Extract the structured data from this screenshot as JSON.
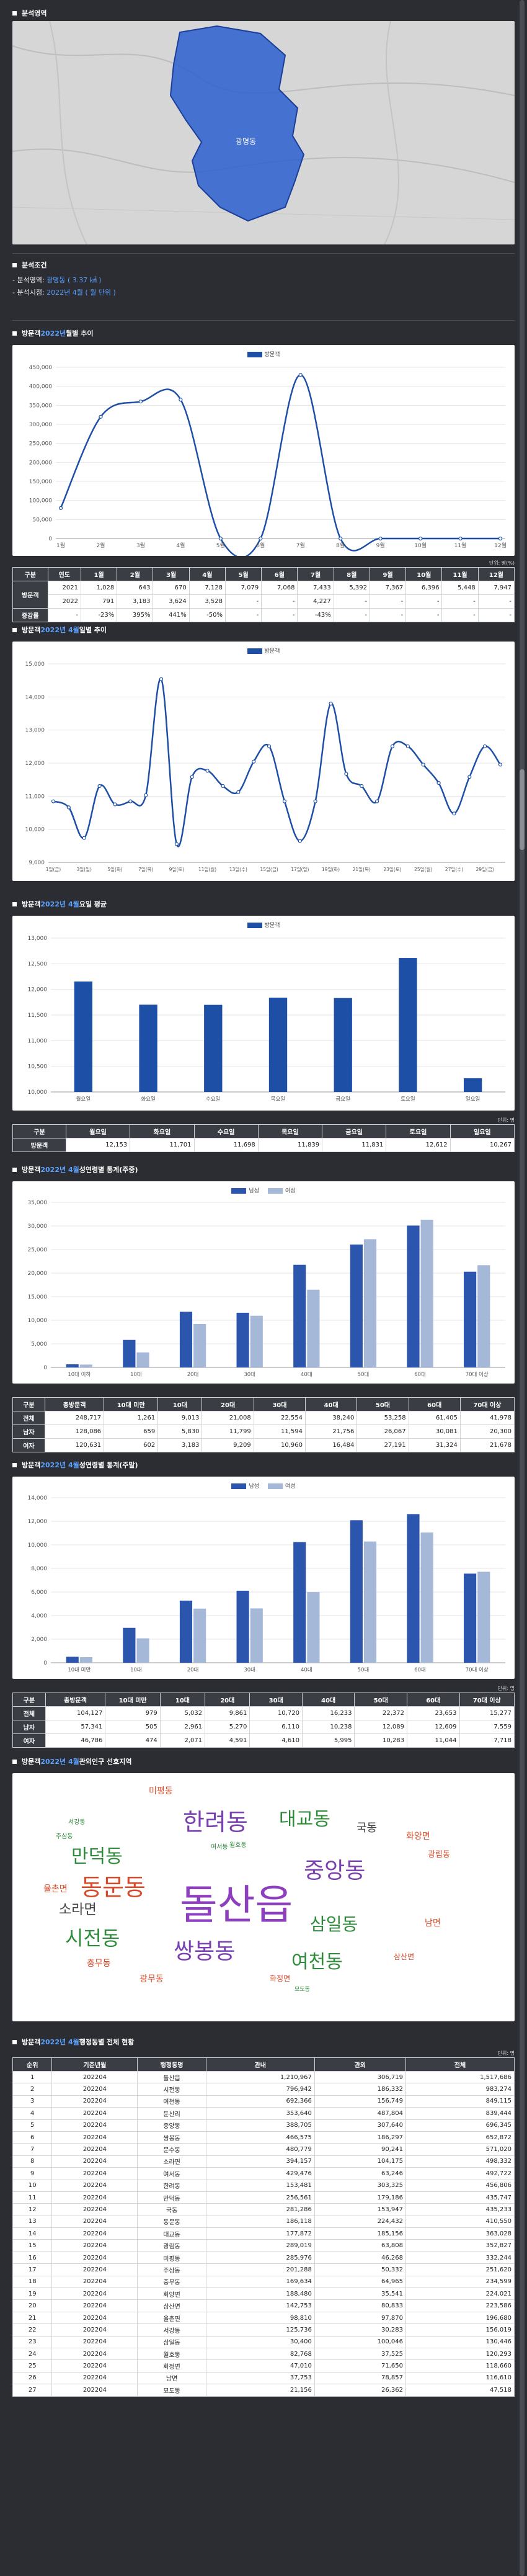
{
  "sections": {
    "area": "분석영역",
    "cond": "분석조건",
    "monthly": {
      "pre": "방문객 ",
      "year": "2022년",
      "post": " 월별 추이"
    },
    "daily": {
      "pre": "방문객 ",
      "period": "2022년 4월",
      "post": " 일별 추이"
    },
    "weekday": {
      "pre": "방문객 ",
      "period": "2022년 4월",
      "post": " 요일 평균"
    },
    "demo_weekday": {
      "pre": "방문객 ",
      "period": "2022년 4월",
      "post": " 성연령별 통계(주중)"
    },
    "demo_weekend": {
      "pre": "방문객 ",
      "period": "2022년 4월",
      "post": " 성연령별 통계(주말)"
    },
    "related": {
      "pre": "방문객 ",
      "period": "2022년 4월",
      "post": " 관외인구 선호지역"
    },
    "admin": {
      "pre": "방문객 ",
      "period": "2022년 4월",
      "post": " 행정동별 전체 현황"
    }
  },
  "conditions": {
    "area_label": "- 분석영역: ",
    "area_value": "광명동 ( 3.37 ㎢ )",
    "time_label": "- 분석시점: ",
    "time_value": "2022년 4월 ( 월 단위 )"
  },
  "map": {
    "label": "광명동"
  },
  "unit_label": "단위: 명",
  "unit_label_pct": "단위: 명(%)",
  "colors": {
    "primary": "#1e4fa6",
    "male": "#2c56ad",
    "female": "#a6b8d8",
    "accent": "#5aa0ff"
  },
  "monthly_chart": {
    "type": "line",
    "legend": "방문객",
    "categories": [
      "1월",
      "2월",
      "3월",
      "4월",
      "5월",
      "6월",
      "7월",
      "8월",
      "9월",
      "10월",
      "11월",
      "12월"
    ],
    "values": [
      80000,
      320000,
      360000,
      365000,
      0,
      0,
      430000,
      0,
      0,
      0,
      0,
      0
    ],
    "ylim": [
      0,
      450000
    ],
    "yticks": [
      "0",
      "50,000",
      "100,000",
      "150,000",
      "200,000",
      "250,000",
      "300,000",
      "350,000",
      "400,000",
      "450,000"
    ]
  },
  "monthly_table": {
    "headers": [
      "구분",
      "연도",
      "1월",
      "2월",
      "3월",
      "4월",
      "5월",
      "6월",
      "7월",
      "8월",
      "9월",
      "10월",
      "11월",
      "12월"
    ],
    "row_header": "방문객",
    "rows": [
      [
        "2021",
        "1,028",
        "643",
        "670",
        "7,128",
        "7,079",
        "7,068",
        "7,433",
        "5,392",
        "7,367",
        "6,396",
        "5,448",
        "7,947"
      ],
      [
        "2022",
        "791",
        "3,183",
        "3,624",
        "3,528",
        "-",
        "-",
        "4,227",
        "-",
        "-",
        "-",
        "-",
        "-"
      ]
    ],
    "growth": [
      "증감률",
      "-",
      "-23%",
      "395%",
      "441%",
      "-50%",
      "-",
      "-",
      "-43%",
      "-",
      "-",
      "-",
      "-",
      "-"
    ]
  },
  "daily_chart": {
    "type": "line",
    "legend": "방문객",
    "categories": [
      "1일(금)",
      "3일(일)",
      "5일(화)",
      "7일(목)",
      "9일(토)",
      "11일(월)",
      "13일(수)",
      "15일(금)",
      "17일(일)",
      "19일(화)",
      "21일(목)",
      "23일(토)",
      "25일(월)",
      "27일(수)",
      "29일(금)"
    ],
    "values": [
      11000,
      10800,
      9800,
      11500,
      10900,
      11000,
      11200,
      15000,
      9600,
      11800,
      12000,
      11500,
      11300,
      12300,
      12800,
      11000,
      9700,
      11000,
      14200,
      11900,
      11500,
      11000,
      12800,
      12800,
      12200,
      11600,
      10600,
      11800,
      12800,
      12200
    ],
    "ylim": [
      9000,
      15500
    ],
    "yticks": [
      "9,000",
      "10,000",
      "11,000",
      "12,000",
      "13,000",
      "14,000",
      "15,000"
    ]
  },
  "weekday_chart": {
    "type": "bar",
    "legend": "방문객",
    "categories": [
      "월요일",
      "화요일",
      "수요일",
      "목요일",
      "금요일",
      "토요일",
      "일요일"
    ],
    "values": [
      12153,
      11701,
      11698,
      11839,
      11831,
      12612,
      10267
    ],
    "ylim": [
      10000,
      13000
    ],
    "yticks": [
      "10,000",
      "10,500",
      "11,000",
      "11,500",
      "12,000",
      "12,500",
      "13,000"
    ]
  },
  "weekday_table": {
    "headers": [
      "구분",
      "월요일",
      "화요일",
      "수요일",
      "목요일",
      "금요일",
      "토요일",
      "일요일"
    ],
    "row": [
      "방문객",
      "12,153",
      "11,701",
      "11,698",
      "11,839",
      "11,831",
      "12,612",
      "10,267"
    ]
  },
  "demo_weekday_chart": {
    "type": "bar",
    "legend": [
      "남성",
      "여성"
    ],
    "categories": [
      "10대 이하",
      "10대",
      "20대",
      "30대",
      "40대",
      "50대",
      "60대",
      "70대 이상"
    ],
    "series": [
      {
        "name": "남성",
        "values": [
          659,
          5830,
          11799,
          11594,
          21756,
          26067,
          30081,
          20300
        ]
      },
      {
        "name": "여성",
        "values": [
          602,
          3183,
          9209,
          10960,
          16484,
          27191,
          31324,
          21678
        ]
      }
    ],
    "ylim": [
      0,
      35000
    ],
    "yticks": [
      "0",
      "5,000",
      "10,000",
      "15,000",
      "20,000",
      "25,000",
      "30,000",
      "35,000"
    ]
  },
  "demo_weekday_table": {
    "headers": [
      "구분",
      "총방문객",
      "10대 미만",
      "10대",
      "20대",
      "30대",
      "40대",
      "50대",
      "60대",
      "70대 이상"
    ],
    "rows": [
      [
        "전체",
        "248,717",
        "1,261",
        "9,013",
        "21,008",
        "22,554",
        "38,240",
        "53,258",
        "61,405",
        "41,978"
      ],
      [
        "남자",
        "128,086",
        "659",
        "5,830",
        "11,799",
        "11,594",
        "21,756",
        "26,067",
        "30,081",
        "20,300"
      ],
      [
        "여자",
        "120,631",
        "602",
        "3,183",
        "9,209",
        "10,960",
        "16,484",
        "27,191",
        "31,324",
        "21,678"
      ]
    ]
  },
  "demo_weekend_chart": {
    "type": "bar",
    "legend": [
      "남성",
      "여성"
    ],
    "categories": [
      "10대 미만",
      "10대",
      "20대",
      "30대",
      "40대",
      "50대",
      "60대",
      "70대 이상"
    ],
    "series": [
      {
        "name": "남성",
        "values": [
          505,
          2961,
          5270,
          6110,
          10238,
          12089,
          12609,
          7559
        ]
      },
      {
        "name": "여성",
        "values": [
          474,
          2071,
          4591,
          4610,
          5995,
          10283,
          11044,
          7718
        ]
      }
    ],
    "ylim": [
      0,
      14000
    ],
    "yticks": [
      "0",
      "2,000",
      "4,000",
      "6,000",
      "8,000",
      "10,000",
      "12,000",
      "14,000"
    ]
  },
  "demo_weekend_table": {
    "headers": [
      "구분",
      "총방문객",
      "10대 미만",
      "10대",
      "20대",
      "30대",
      "40대",
      "50대",
      "60대",
      "70대 이상"
    ],
    "rows": [
      [
        "전체",
        "104,127",
        "979",
        "5,032",
        "9,861",
        "10,720",
        "16,233",
        "22,372",
        "23,653",
        "15,277"
      ],
      [
        "남자",
        "57,341",
        "505",
        "2,961",
        "5,270",
        "6,110",
        "10,238",
        "12,089",
        "12,609",
        "7,559"
      ],
      [
        "여자",
        "46,786",
        "474",
        "2,071",
        "4,591",
        "4,610",
        "5,995",
        "10,283",
        "11,044",
        "7,718"
      ]
    ]
  },
  "wordcloud": [
    {
      "text": "돌산읍",
      "color": "#8e3fbf",
      "size": 66
    },
    {
      "text": "한려동",
      "color": "#7a3fb0",
      "size": 38
    },
    {
      "text": "대교동",
      "color": "#2e8b3a",
      "size": 30
    },
    {
      "text": "중앙동",
      "color": "#7a3fb0",
      "size": 36
    },
    {
      "text": "동문동",
      "color": "#d94a2a",
      "size": 38
    },
    {
      "text": "만덕동",
      "color": "#2e8b3a",
      "size": 30
    },
    {
      "text": "쌍봉동",
      "color": "#7a3fb0",
      "size": 36
    },
    {
      "text": "시전동",
      "color": "#2e8b3a",
      "size": 32
    },
    {
      "text": "삼일동",
      "color": "#2e8b3a",
      "size": 28
    },
    {
      "text": "여천동",
      "color": "#2e8b3a",
      "size": 30
    },
    {
      "text": "소라면",
      "color": "#444444",
      "size": 22
    },
    {
      "text": "국동",
      "color": "#444444",
      "size": 18
    },
    {
      "text": "화양면",
      "color": "#d94a2a",
      "size": 14
    },
    {
      "text": "율촌면",
      "color": "#d94a2a",
      "size": 14
    },
    {
      "text": "광림동",
      "color": "#d94a2a",
      "size": 13
    },
    {
      "text": "남면",
      "color": "#d94a2a",
      "size": 14
    },
    {
      "text": "삼산면",
      "color": "#d94a2a",
      "size": 12
    },
    {
      "text": "화정면",
      "color": "#d94a2a",
      "size": 12
    },
    {
      "text": "미평동",
      "color": "#d94a2a",
      "size": 14
    },
    {
      "text": "충무동",
      "color": "#d94a2a",
      "size": 14
    },
    {
      "text": "광무동",
      "color": "#d94a2a",
      "size": 14
    },
    {
      "text": "서강동",
      "color": "#2e8b3a",
      "size": 10
    },
    {
      "text": "주삼동",
      "color": "#2e8b3a",
      "size": 10
    },
    {
      "text": "월호동",
      "color": "#2e8b3a",
      "size": 10
    },
    {
      "text": "묘도동",
      "color": "#2e8b3a",
      "size": 9
    },
    {
      "text": "여서동",
      "color": "#2e8b3a",
      "size": 10
    }
  ],
  "admin_table": {
    "headers": [
      "순위",
      "기준년월",
      "행정동명",
      "관내",
      "관외",
      "전체"
    ],
    "rows": [
      [
        "1",
        "202204",
        "돌산읍",
        "1,210,967",
        "306,719",
        "1,517,686"
      ],
      [
        "2",
        "202204",
        "시전동",
        "796,942",
        "186,332",
        "983,274"
      ],
      [
        "3",
        "202204",
        "여천동",
        "692,366",
        "156,749",
        "849,115"
      ],
      [
        "4",
        "202204",
        "둔산리",
        "353,640",
        "487,804",
        "839,444"
      ],
      [
        "5",
        "202204",
        "중앙동",
        "388,705",
        "307,640",
        "696,345"
      ],
      [
        "6",
        "202204",
        "쌍봉동",
        "466,575",
        "186,297",
        "652,872"
      ],
      [
        "7",
        "202204",
        "문수동",
        "480,779",
        "90,241",
        "571,020"
      ],
      [
        "8",
        "202204",
        "소라면",
        "394,157",
        "104,175",
        "498,332"
      ],
      [
        "9",
        "202204",
        "여서동",
        "429,476",
        "63,246",
        "492,722"
      ],
      [
        "10",
        "202204",
        "한려동",
        "153,481",
        "303,325",
        "456,806"
      ],
      [
        "11",
        "202204",
        "만덕동",
        "256,561",
        "179,186",
        "435,747"
      ],
      [
        "12",
        "202204",
        "국동",
        "281,286",
        "153,947",
        "435,233"
      ],
      [
        "13",
        "202204",
        "동문동",
        "186,118",
        "224,432",
        "410,550"
      ],
      [
        "14",
        "202204",
        "대교동",
        "177,872",
        "185,156",
        "363,028"
      ],
      [
        "15",
        "202204",
        "광림동",
        "289,019",
        "63,808",
        "352,827"
      ],
      [
        "16",
        "202204",
        "미평동",
        "285,976",
        "46,268",
        "332,244"
      ],
      [
        "17",
        "202204",
        "주삼동",
        "201,288",
        "50,332",
        "251,620"
      ],
      [
        "18",
        "202204",
        "충무동",
        "169,634",
        "64,965",
        "234,599"
      ],
      [
        "19",
        "202204",
        "화양면",
        "188,480",
        "35,541",
        "224,021"
      ],
      [
        "20",
        "202204",
        "삼산면",
        "142,753",
        "80,833",
        "223,586"
      ],
      [
        "21",
        "202204",
        "율촌면",
        "98,810",
        "97,870",
        "196,680"
      ],
      [
        "22",
        "202204",
        "서강동",
        "125,736",
        "30,283",
        "156,019"
      ],
      [
        "23",
        "202204",
        "삼일동",
        "30,400",
        "100,046",
        "130,446"
      ],
      [
        "24",
        "202204",
        "월호동",
        "82,768",
        "37,525",
        "120,293"
      ],
      [
        "25",
        "202204",
        "화정면",
        "47,010",
        "71,650",
        "118,660"
      ],
      [
        "26",
        "202204",
        "남면",
        "37,753",
        "78,857",
        "116,610"
      ],
      [
        "27",
        "202204",
        "묘도동",
        "21,156",
        "26,362",
        "47,518"
      ]
    ]
  }
}
